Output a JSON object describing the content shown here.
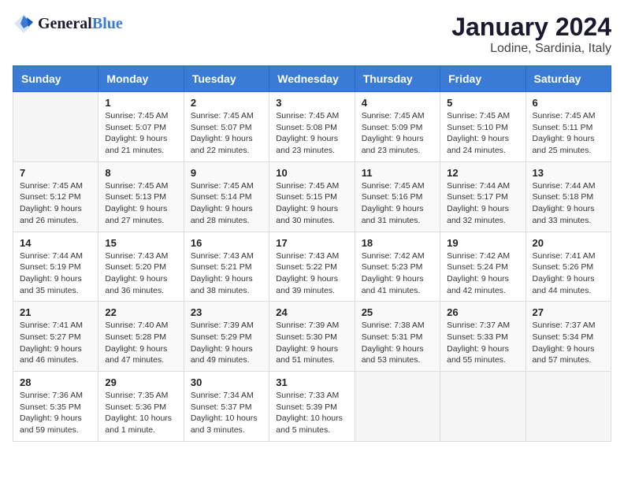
{
  "header": {
    "logo_general": "General",
    "logo_blue": "Blue",
    "month_title": "January 2024",
    "location": "Lodine, Sardinia, Italy"
  },
  "days_of_week": [
    "Sunday",
    "Monday",
    "Tuesday",
    "Wednesday",
    "Thursday",
    "Friday",
    "Saturday"
  ],
  "weeks": [
    [
      {
        "day": "",
        "info": ""
      },
      {
        "day": "1",
        "info": "Sunrise: 7:45 AM\nSunset: 5:07 PM\nDaylight: 9 hours\nand 21 minutes."
      },
      {
        "day": "2",
        "info": "Sunrise: 7:45 AM\nSunset: 5:07 PM\nDaylight: 9 hours\nand 22 minutes."
      },
      {
        "day": "3",
        "info": "Sunrise: 7:45 AM\nSunset: 5:08 PM\nDaylight: 9 hours\nand 23 minutes."
      },
      {
        "day": "4",
        "info": "Sunrise: 7:45 AM\nSunset: 5:09 PM\nDaylight: 9 hours\nand 23 minutes."
      },
      {
        "day": "5",
        "info": "Sunrise: 7:45 AM\nSunset: 5:10 PM\nDaylight: 9 hours\nand 24 minutes."
      },
      {
        "day": "6",
        "info": "Sunrise: 7:45 AM\nSunset: 5:11 PM\nDaylight: 9 hours\nand 25 minutes."
      }
    ],
    [
      {
        "day": "7",
        "info": "Sunrise: 7:45 AM\nSunset: 5:12 PM\nDaylight: 9 hours\nand 26 minutes."
      },
      {
        "day": "8",
        "info": "Sunrise: 7:45 AM\nSunset: 5:13 PM\nDaylight: 9 hours\nand 27 minutes."
      },
      {
        "day": "9",
        "info": "Sunrise: 7:45 AM\nSunset: 5:14 PM\nDaylight: 9 hours\nand 28 minutes."
      },
      {
        "day": "10",
        "info": "Sunrise: 7:45 AM\nSunset: 5:15 PM\nDaylight: 9 hours\nand 30 minutes."
      },
      {
        "day": "11",
        "info": "Sunrise: 7:45 AM\nSunset: 5:16 PM\nDaylight: 9 hours\nand 31 minutes."
      },
      {
        "day": "12",
        "info": "Sunrise: 7:44 AM\nSunset: 5:17 PM\nDaylight: 9 hours\nand 32 minutes."
      },
      {
        "day": "13",
        "info": "Sunrise: 7:44 AM\nSunset: 5:18 PM\nDaylight: 9 hours\nand 33 minutes."
      }
    ],
    [
      {
        "day": "14",
        "info": "Sunrise: 7:44 AM\nSunset: 5:19 PM\nDaylight: 9 hours\nand 35 minutes."
      },
      {
        "day": "15",
        "info": "Sunrise: 7:43 AM\nSunset: 5:20 PM\nDaylight: 9 hours\nand 36 minutes."
      },
      {
        "day": "16",
        "info": "Sunrise: 7:43 AM\nSunset: 5:21 PM\nDaylight: 9 hours\nand 38 minutes."
      },
      {
        "day": "17",
        "info": "Sunrise: 7:43 AM\nSunset: 5:22 PM\nDaylight: 9 hours\nand 39 minutes."
      },
      {
        "day": "18",
        "info": "Sunrise: 7:42 AM\nSunset: 5:23 PM\nDaylight: 9 hours\nand 41 minutes."
      },
      {
        "day": "19",
        "info": "Sunrise: 7:42 AM\nSunset: 5:24 PM\nDaylight: 9 hours\nand 42 minutes."
      },
      {
        "day": "20",
        "info": "Sunrise: 7:41 AM\nSunset: 5:26 PM\nDaylight: 9 hours\nand 44 minutes."
      }
    ],
    [
      {
        "day": "21",
        "info": "Sunrise: 7:41 AM\nSunset: 5:27 PM\nDaylight: 9 hours\nand 46 minutes."
      },
      {
        "day": "22",
        "info": "Sunrise: 7:40 AM\nSunset: 5:28 PM\nDaylight: 9 hours\nand 47 minutes."
      },
      {
        "day": "23",
        "info": "Sunrise: 7:39 AM\nSunset: 5:29 PM\nDaylight: 9 hours\nand 49 minutes."
      },
      {
        "day": "24",
        "info": "Sunrise: 7:39 AM\nSunset: 5:30 PM\nDaylight: 9 hours\nand 51 minutes."
      },
      {
        "day": "25",
        "info": "Sunrise: 7:38 AM\nSunset: 5:31 PM\nDaylight: 9 hours\nand 53 minutes."
      },
      {
        "day": "26",
        "info": "Sunrise: 7:37 AM\nSunset: 5:33 PM\nDaylight: 9 hours\nand 55 minutes."
      },
      {
        "day": "27",
        "info": "Sunrise: 7:37 AM\nSunset: 5:34 PM\nDaylight: 9 hours\nand 57 minutes."
      }
    ],
    [
      {
        "day": "28",
        "info": "Sunrise: 7:36 AM\nSunset: 5:35 PM\nDaylight: 9 hours\nand 59 minutes."
      },
      {
        "day": "29",
        "info": "Sunrise: 7:35 AM\nSunset: 5:36 PM\nDaylight: 10 hours\nand 1 minute."
      },
      {
        "day": "30",
        "info": "Sunrise: 7:34 AM\nSunset: 5:37 PM\nDaylight: 10 hours\nand 3 minutes."
      },
      {
        "day": "31",
        "info": "Sunrise: 7:33 AM\nSunset: 5:39 PM\nDaylight: 10 hours\nand 5 minutes."
      },
      {
        "day": "",
        "info": ""
      },
      {
        "day": "",
        "info": ""
      },
      {
        "day": "",
        "info": ""
      }
    ]
  ]
}
